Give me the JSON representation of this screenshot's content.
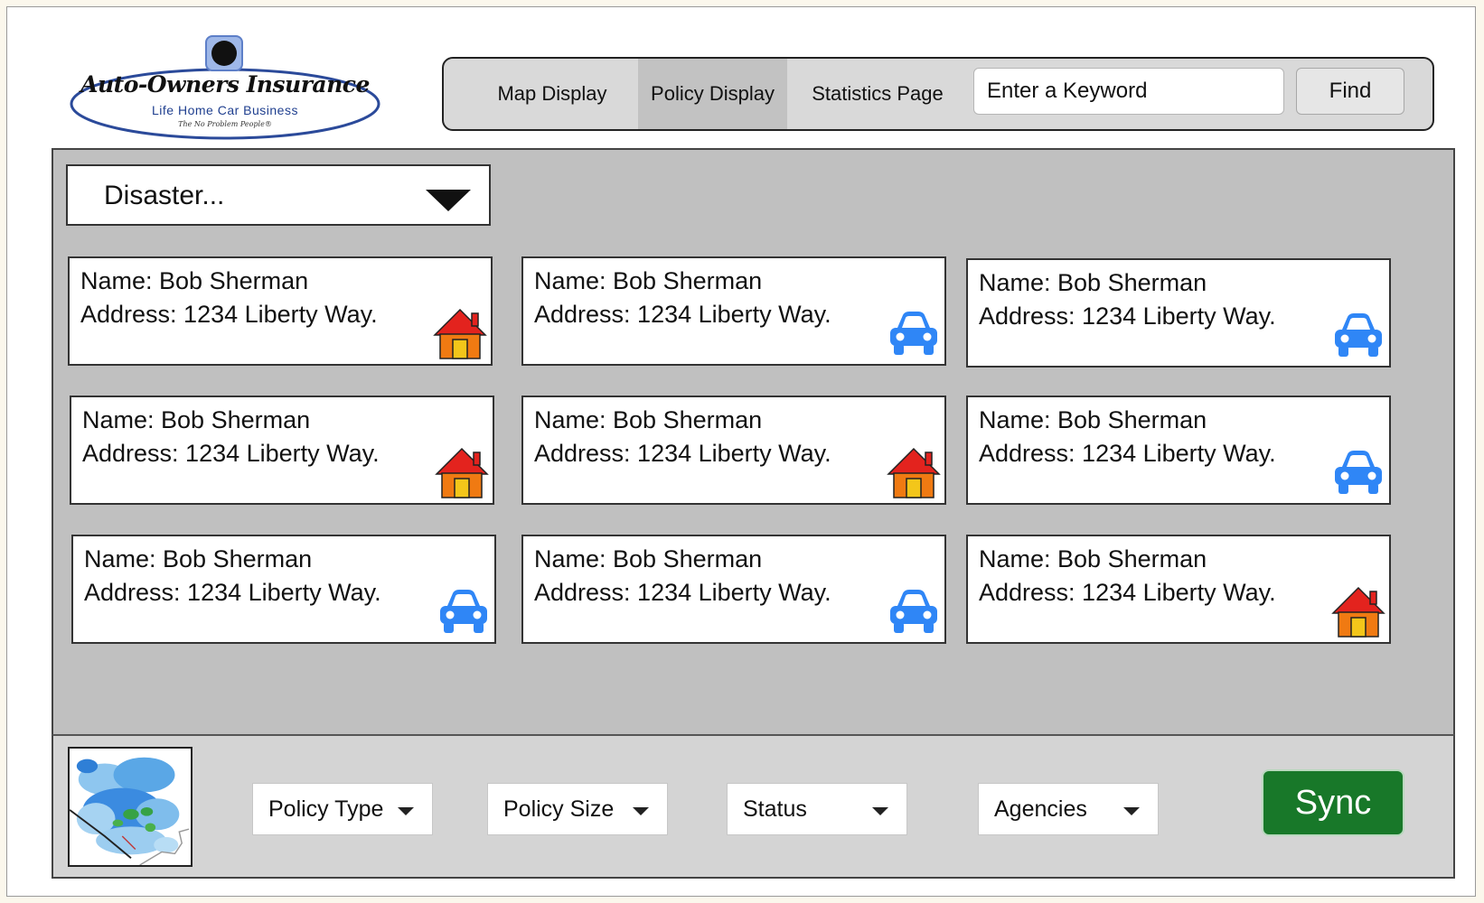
{
  "logo": {
    "name": "Auto-Owners Insurance",
    "subtitle": "Life Home Car Business",
    "tagline": "The No Problem People®"
  },
  "nav": {
    "tabs": [
      {
        "label": "Map Display",
        "active": false
      },
      {
        "label": "Policy Display",
        "active": true
      },
      {
        "label": "Statistics Page",
        "active": false
      }
    ],
    "search_placeholder": "Enter a Keyword",
    "find_label": "Find"
  },
  "disaster_select": {
    "selected": "Disaster..."
  },
  "cards": [
    {
      "name": "Name: Bob Sherman",
      "address": "Address: 1234 Liberty Way.",
      "icon": "house-icon"
    },
    {
      "name": "Name: Bob Sherman",
      "address": "Address: 1234 Liberty Way.",
      "icon": "car-icon"
    },
    {
      "name": "Name: Bob Sherman",
      "address": "Address: 1234 Liberty Way.",
      "icon": "car-icon"
    },
    {
      "name": "Name: Bob Sherman",
      "address": "Address: 1234 Liberty Way.",
      "icon": "house-icon"
    },
    {
      "name": "Name: Bob Sherman",
      "address": "Address: 1234 Liberty Way.",
      "icon": "house-icon"
    },
    {
      "name": "Name: Bob Sherman",
      "address": "Address: 1234 Liberty Way.",
      "icon": "car-icon"
    },
    {
      "name": "Name: Bob Sherman",
      "address": "Address: 1234 Liberty Way.",
      "icon": "car-icon"
    },
    {
      "name": "Name: Bob Sherman",
      "address": "Address: 1234 Liberty Way.",
      "icon": "car-icon"
    },
    {
      "name": "Name: Bob Sherman",
      "address": "Address: 1234 Liberty Way.",
      "icon": "house-icon"
    }
  ],
  "filters": {
    "policy_type": "Policy Type",
    "policy_size": "Policy Size",
    "status": "Status",
    "agencies": "Agencies"
  },
  "sync_label": "Sync",
  "colors": {
    "panel": "#c0c0c0",
    "bottom_bar": "#d4d4d4",
    "sync_button": "#187829",
    "car_icon": "#2f86f6",
    "house_roof": "#e3231e",
    "house_wall": "#f07a12",
    "house_door": "#f3c61a"
  }
}
